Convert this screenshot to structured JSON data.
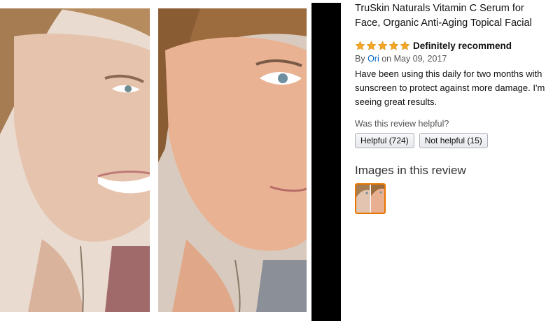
{
  "product": {
    "title_line1": "TruSkin Naturals Vitamin C Serum for",
    "title_line2": "Face, Organic Anti-Aging Topical Facial"
  },
  "review": {
    "rating": 5,
    "rating_max": 5,
    "headline": "Definitely recommend",
    "by_prefix": "By",
    "author": "Ori",
    "date": "on May 09, 2017",
    "body_line1": "Have been using this daily for two months with",
    "body_line2": "sunscreen to protect against more damage. I'm",
    "body_line3": "seeing great results.",
    "helpful_question": "Was this review helpful?",
    "helpful_button": "Helpful (724)",
    "not_helpful_button": "Not helpful (15)"
  },
  "images_section": {
    "title": "Images in this review"
  },
  "colors": {
    "star": "#f5a623",
    "link": "#0066c0",
    "thumb_border": "#e77600"
  }
}
